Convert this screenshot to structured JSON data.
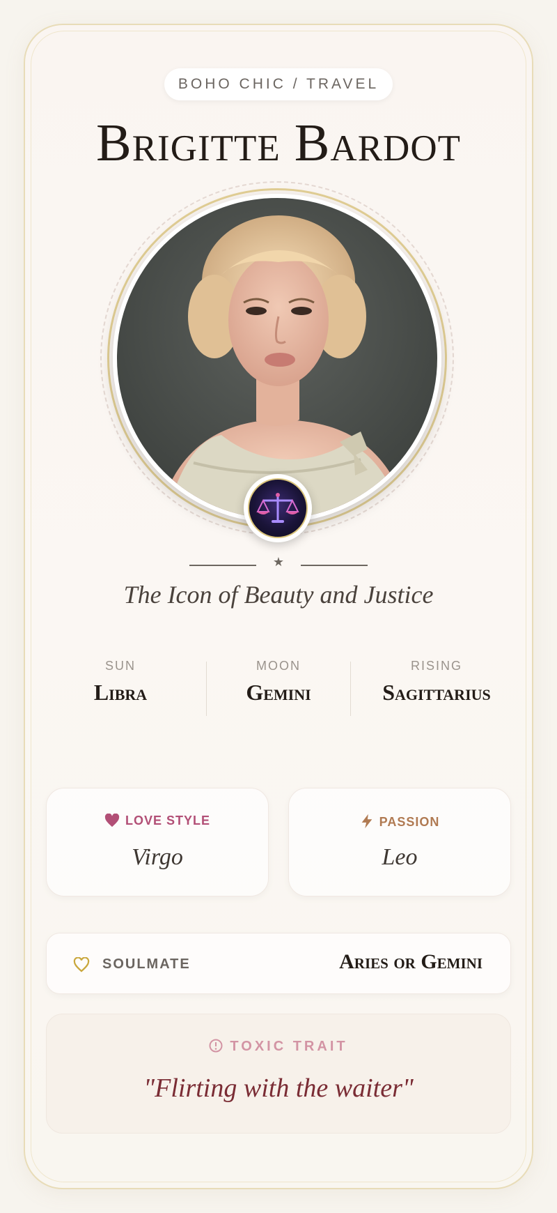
{
  "category_pill": "BOHO CHIC / TRAVEL",
  "profile": {
    "name": "Brigitte Bardot",
    "tagline": "The Icon of Beauty and Justice",
    "zodiac_badge_icon": "libra-scales-icon"
  },
  "signs": {
    "sun": {
      "label": "SUN",
      "value": "Libra"
    },
    "moon": {
      "label": "MOON",
      "value": "Gemini"
    },
    "rising": {
      "label": "RISING",
      "value": "Sagittarius"
    }
  },
  "love_style": {
    "label": "LOVE STYLE",
    "value": "Virgo",
    "icon": "heart-icon",
    "color": "#b24f76"
  },
  "passion": {
    "label": "PASSION",
    "value": "Leo",
    "icon": "lightning-icon",
    "color": "#b07a52"
  },
  "soulmate": {
    "label": "SOULMATE",
    "value": "Aries or Gemini",
    "icon": "heart-outline-icon"
  },
  "toxic_trait": {
    "label": "TOXIC TRAIT",
    "value": "\"Flirting with the waiter\"",
    "icon": "alert-circle-icon"
  },
  "colors": {
    "gold": "#e2cf95",
    "background": "#f7f4ee",
    "text_dark": "#231c17"
  }
}
